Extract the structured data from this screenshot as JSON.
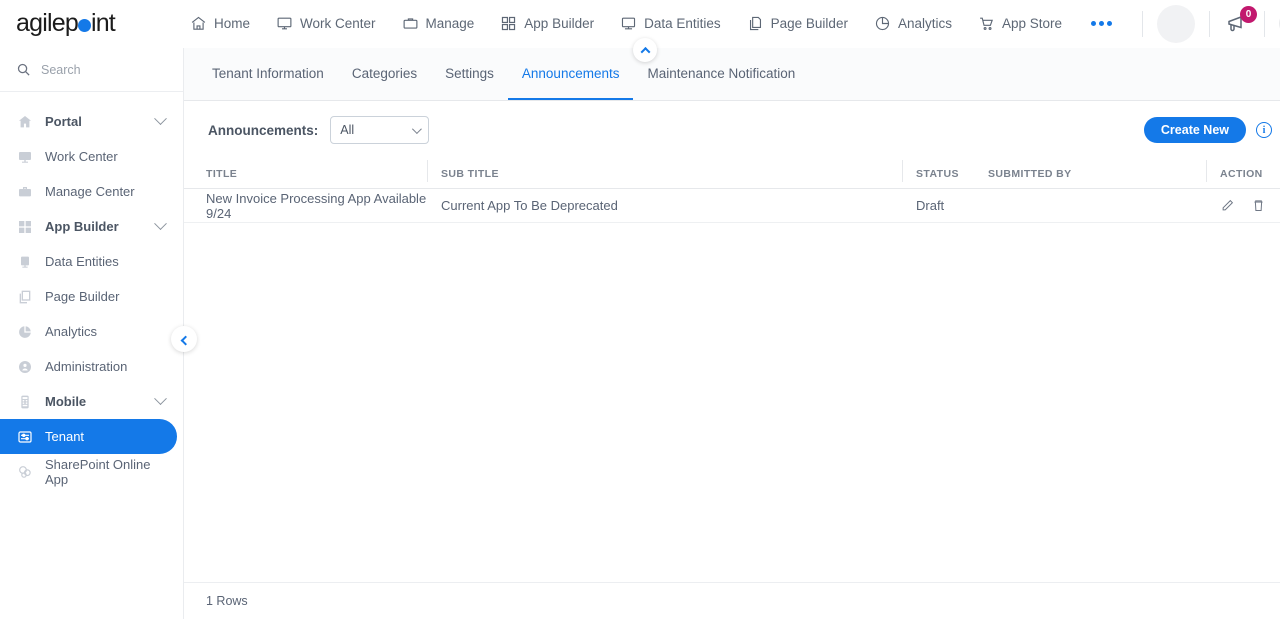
{
  "brand": {
    "name_part1": "agilep",
    "name_part2": "int",
    "accent": "#1479e8",
    "badge_color": "#c2186e"
  },
  "topnav": {
    "items": [
      {
        "label": "Home",
        "icon": "home-icon"
      },
      {
        "label": "Work Center",
        "icon": "monitor-icon"
      },
      {
        "label": "Manage",
        "icon": "briefcase-icon"
      },
      {
        "label": "App Builder",
        "icon": "grid-icon"
      },
      {
        "label": "Data Entities",
        "icon": "display-icon"
      },
      {
        "label": "Page Builder",
        "icon": "pages-icon"
      },
      {
        "label": "Analytics",
        "icon": "pie-chart-icon"
      },
      {
        "label": "App Store",
        "icon": "cart-icon"
      }
    ],
    "overflow": "more-icon",
    "notification_count": "0",
    "user_name": ""
  },
  "sidebar": {
    "search": {
      "placeholder": "Search"
    },
    "items": [
      {
        "label": "Portal",
        "icon": "home-icon",
        "expandable": true,
        "active": false
      },
      {
        "label": "Work Center",
        "icon": "monitor-icon",
        "expandable": false,
        "active": false
      },
      {
        "label": "Manage Center",
        "icon": "briefcase-icon",
        "expandable": false,
        "active": false
      },
      {
        "label": "App Builder",
        "icon": "grid-icon",
        "expandable": true,
        "active": false
      },
      {
        "label": "Data Entities",
        "icon": "display-icon",
        "expandable": false,
        "active": false
      },
      {
        "label": "Page Builder",
        "icon": "pages-icon",
        "expandable": false,
        "active": false
      },
      {
        "label": "Analytics",
        "icon": "pie-chart-icon",
        "expandable": false,
        "active": false
      },
      {
        "label": "Administration",
        "icon": "user-lock-icon",
        "expandable": false,
        "active": false
      },
      {
        "label": "Mobile",
        "icon": "mobile-icon",
        "expandable": true,
        "active": false
      },
      {
        "label": "Tenant",
        "icon": "sliders-icon",
        "expandable": false,
        "active": true
      },
      {
        "label": "SharePoint Online App",
        "icon": "sharepoint-icon",
        "expandable": false,
        "active": false
      }
    ]
  },
  "main": {
    "tabs": [
      {
        "label": "Tenant Information",
        "active": false
      },
      {
        "label": "Categories",
        "active": false
      },
      {
        "label": "Settings",
        "active": false
      },
      {
        "label": "Announcements",
        "active": true
      },
      {
        "label": "Maintenance Notification",
        "active": false
      }
    ],
    "filter": {
      "label": "Announcements:",
      "selected": "All",
      "options": [
        "All"
      ]
    },
    "create_button": "Create New",
    "info_icon_label": "i",
    "table": {
      "columns": [
        "TITLE",
        "SUB TITLE",
        "STATUS",
        "SUBMITTED BY",
        "ACTION"
      ],
      "rows": [
        {
          "title": "New Invoice Processing App Available 9/24",
          "sub_title": "Current App To Be Deprecated",
          "status": "Draft",
          "submitted_by": "",
          "actions": [
            "edit-icon",
            "delete-icon"
          ]
        }
      ]
    },
    "footer_rows": "1 Rows"
  }
}
